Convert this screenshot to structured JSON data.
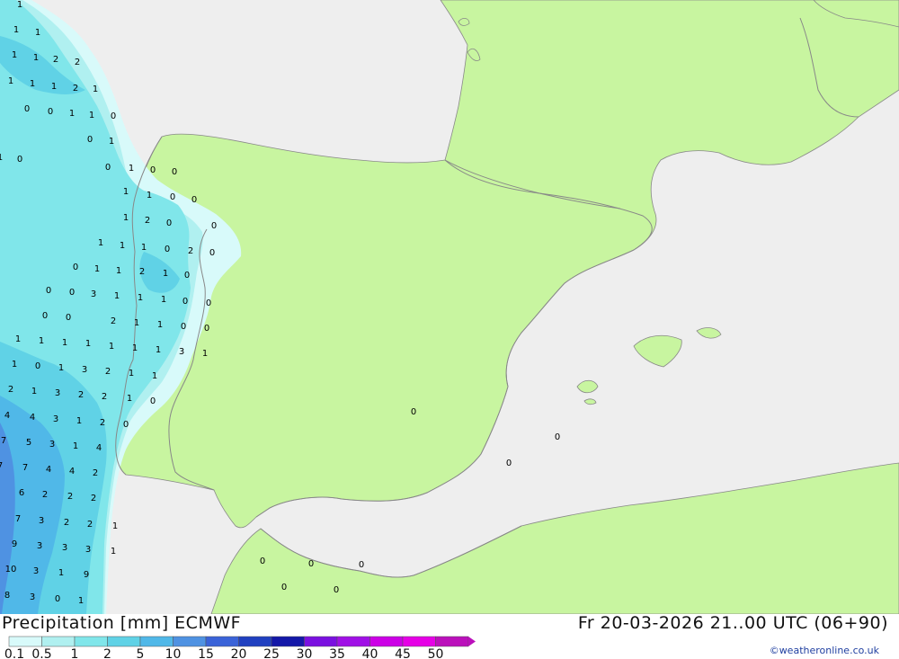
{
  "header": {
    "title": "Precipitation [mm] ECMWF",
    "datetime": "Fr 20-03-2026 21..00 UTC (06+90)",
    "credit": "©weatheronline.co.uk"
  },
  "colors": {
    "sea": "#eeeeee",
    "land": "#c8f5a0",
    "border": "#9a9a9a",
    "coast": "#888888"
  },
  "legend": {
    "labels": [
      "0.1",
      "0.5",
      "1",
      "2",
      "5",
      "10",
      "15",
      "20",
      "25",
      "30",
      "35",
      "40",
      "45",
      "50"
    ],
    "colors": [
      "#d8fafa",
      "#b0f0f0",
      "#80e6ea",
      "#60d2e6",
      "#50b8e8",
      "#4f92e2",
      "#3a63d8",
      "#2040c0",
      "#1418a8",
      "#7a10e0",
      "#a010e6",
      "#cc00e6",
      "#e600e6",
      "#bb10bb"
    ]
  },
  "map_values": {
    "values": [
      "1",
      "1",
      "1",
      "2",
      "2",
      "1",
      "1",
      "1",
      "1",
      "1",
      "2",
      "1",
      "0",
      "0",
      "1",
      "1",
      "0",
      "0",
      "1",
      "1",
      "0",
      "0",
      "1",
      "0",
      "0",
      "1",
      "1",
      "0",
      "0",
      "1",
      "2",
      "0",
      "0",
      "1",
      "1",
      "1",
      "0",
      "2",
      "0",
      "0",
      "1",
      "1",
      "2",
      "1",
      "0",
      "0",
      "0",
      "3",
      "1",
      "1",
      "1",
      "0",
      "0",
      "0",
      "0",
      "2",
      "1",
      "1",
      "0",
      "0",
      "1",
      "1",
      "1",
      "1",
      "1",
      "1",
      "1",
      "3",
      "1",
      "1",
      "0",
      "1",
      "3",
      "2",
      "1",
      "1",
      "2",
      "1",
      "3",
      "2",
      "2",
      "1",
      "0",
      "4",
      "4",
      "3",
      "1",
      "2",
      "0",
      "7",
      "5",
      "3",
      "1",
      "4",
      "7",
      "7",
      "4",
      "4",
      "2",
      "6",
      "2",
      "2",
      "2",
      "7",
      "3",
      "2",
      "2",
      "1",
      "9",
      "3",
      "3",
      "3",
      "1",
      "10",
      "3",
      "1",
      "9",
      "8",
      "3",
      "0",
      "1",
      "0",
      "0",
      "0",
      "0",
      "0",
      "0",
      "0",
      "0"
    ]
  }
}
